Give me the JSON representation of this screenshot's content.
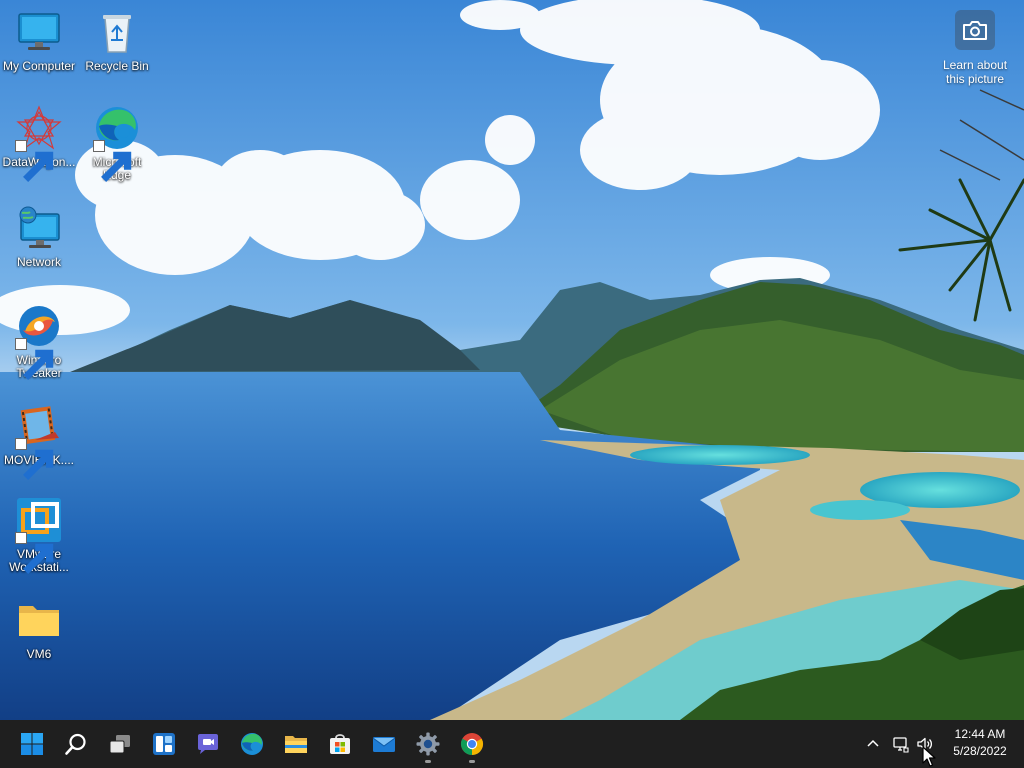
{
  "desktop": {
    "icons": [
      {
        "label": "My Computer",
        "icon": "monitor-icon"
      },
      {
        "label": "Recycle Bin",
        "icon": "recycle-bin-icon"
      },
      {
        "label": "DataWagon...",
        "icon": "datawagon-icon"
      },
      {
        "label": "Microsoft Edge",
        "icon": "edge-icon"
      },
      {
        "label": "Network",
        "icon": "network-icon"
      },
      {
        "label": "Winaero Tweaker",
        "icon": "winaero-tweaker-icon"
      },
      {
        "label": "MOVIEMK....",
        "icon": "movie-maker-icon"
      },
      {
        "label": "VMware Workstati...",
        "icon": "vmware-icon"
      },
      {
        "label": "VM6",
        "icon": "folder-icon"
      }
    ],
    "learn_about": "Learn about this picture"
  },
  "taskbar": {
    "apps": [
      {
        "name": "Start",
        "icon": "windows-start-icon"
      },
      {
        "name": "Search",
        "icon": "search-icon"
      },
      {
        "name": "Task View",
        "icon": "task-view-icon"
      },
      {
        "name": "Widgets",
        "icon": "widgets-icon"
      },
      {
        "name": "Chat",
        "icon": "teams-chat-icon"
      },
      {
        "name": "Microsoft Edge",
        "icon": "edge-icon"
      },
      {
        "name": "File Explorer",
        "icon": "file-explorer-icon"
      },
      {
        "name": "Microsoft Store",
        "icon": "store-icon"
      },
      {
        "name": "Mail",
        "icon": "mail-icon"
      },
      {
        "name": "Settings",
        "icon": "settings-gear-icon"
      },
      {
        "name": "Google Chrome",
        "icon": "chrome-icon"
      }
    ],
    "tray": {
      "time": "12:44 AM",
      "date": "5/28/2022"
    }
  },
  "colors": {
    "taskbar": "#1f1f1f",
    "sky": "#3f8fd9",
    "water": "#1e5fb0",
    "accent": "#0078d4"
  }
}
